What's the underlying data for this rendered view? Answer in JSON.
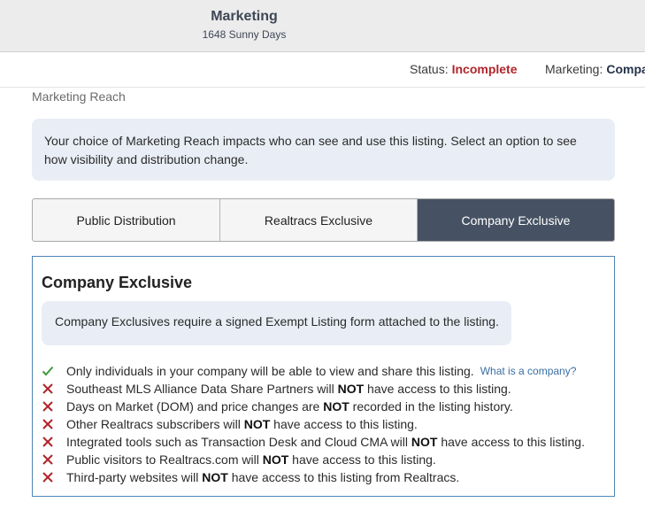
{
  "header": {
    "title": "Marketing",
    "subtitle": "1648 Sunny Days"
  },
  "status_bar": {
    "status_label": "Status:",
    "status_value": "Incomplete",
    "marketing_label": "Marketing:",
    "marketing_value": "Company Exclusive"
  },
  "marketing_reach": {
    "label": "Marketing Reach",
    "info": "Your choice of Marketing Reach impacts who can see and use this listing. Select an option to see how visibility and distribution change.",
    "tabs": [
      {
        "label": "Public Distribution",
        "active": false
      },
      {
        "label": "Realtracs Exclusive",
        "active": false
      },
      {
        "label": "Company Exclusive",
        "active": true
      }
    ]
  },
  "detail": {
    "title": "Company Exclusive",
    "note": "Company Exclusives require a signed Exempt Listing form attached to the listing.",
    "link_label": "What is a company?",
    "rules": [
      {
        "icon": "check-icon",
        "before": "Only individuals in your company will be able to view and share this listing.",
        "bold": "",
        "after": ""
      },
      {
        "icon": "x-icon",
        "before": "Southeast MLS Alliance Data Share Partners will ",
        "bold": "NOT",
        "after": " have access to this listing."
      },
      {
        "icon": "x-icon",
        "before": "Days on Market (DOM) and price changes are ",
        "bold": "NOT",
        "after": " recorded in the listing history."
      },
      {
        "icon": "x-icon",
        "before": "Other Realtracs subscribers will ",
        "bold": "NOT",
        "after": " have access to this listing."
      },
      {
        "icon": "x-icon",
        "before": "Integrated tools such as Transaction Desk and Cloud CMA will ",
        "bold": "NOT",
        "after": " have access to this listing."
      },
      {
        "icon": "x-icon",
        "before": "Public visitors to Realtracs.com will ",
        "bold": "NOT",
        "after": " have access to this listing."
      },
      {
        "icon": "x-icon",
        "before": "Third-party websites will ",
        "bold": "NOT",
        "after": " have access to this listing from Realtracs."
      }
    ]
  },
  "colors": {
    "check": "#3f9a3a",
    "cross": "#b0252b",
    "active_tab": "#465263",
    "incomplete": "#b0252b",
    "panel_border": "#4f86b5"
  }
}
